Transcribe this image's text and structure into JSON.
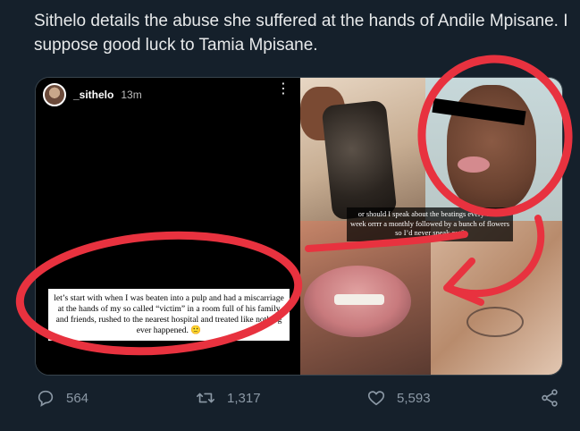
{
  "tweet": {
    "text": "Sithelo details the abuse she suffered at the hands of Andile Mpisane. I suppose good luck to Tamia Mpisane."
  },
  "story": {
    "username": "_sithelo",
    "time": "13m",
    "more_icon": "more-icon",
    "caption": "let’s start with when I was beaten into a pulp and had a miscarriage at the hands of my so called “victim” in a room full of his family and friends, rushed to the nearest hospital and treated like nothing ever happened. 🙂"
  },
  "collage": {
    "caption": "or should I speak about the beatings every other week orrrr a monthly followed by a bunch of flowers so I’d never speak out?"
  },
  "actions": {
    "reply_count": "564",
    "retweet_count": "1,317",
    "like_count": "5,593",
    "icons": [
      "reply-icon",
      "retweet-icon",
      "like-icon",
      "share-icon"
    ]
  },
  "colors": {
    "background": "#15202b",
    "text": "#e7e9ea",
    "muted": "#8b98a5",
    "annotation_red": "#e8323f"
  }
}
